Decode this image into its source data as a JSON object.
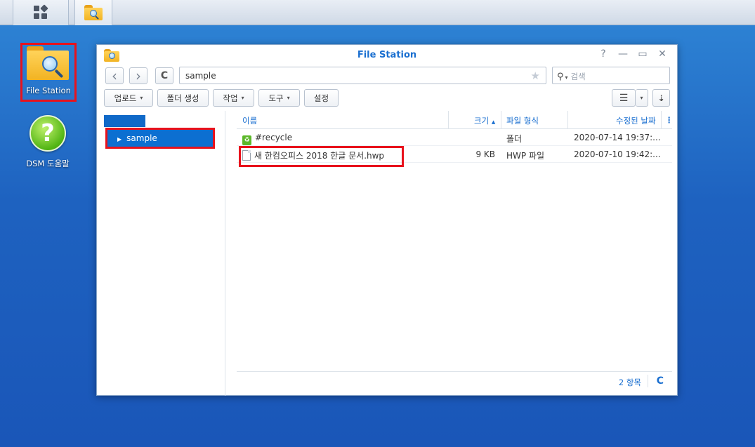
{
  "desktop": {
    "file_station_label": "File Station",
    "help_label": "DSM 도움말",
    "help_glyph": "?"
  },
  "window": {
    "title": "File Station",
    "help_btn": "?",
    "min_btn": "—",
    "max_btn": "▭",
    "close_btn": "✕"
  },
  "nav": {
    "back": "‹",
    "forward": "›",
    "refresh": "C",
    "path": "sample",
    "search_placeholder": "검색"
  },
  "toolbar": {
    "upload": "업로드",
    "new_folder": "폴더 생성",
    "action": "작업",
    "tools": "도구",
    "settings": "설정"
  },
  "tree": {
    "items": [
      {
        "label": "sample"
      }
    ]
  },
  "list": {
    "headers": {
      "name": "이름",
      "size": "크기",
      "type": "파일 형식",
      "modified": "수정된 날짜"
    },
    "rows": [
      {
        "name": "#recycle",
        "size": "",
        "type": "폴더",
        "modified": "2020-07-14 19:37:..."
      },
      {
        "name": "새 한컴오피스 2018 한글 문서.hwp",
        "size": "9 KB",
        "type": "HWP 파일",
        "modified": "2020-07-10 19:42:..."
      }
    ]
  },
  "status": {
    "count": "2 항목"
  },
  "colors": {
    "highlight": "#e8121c",
    "accent": "#1a6fd0",
    "selection": "#0c6fd1"
  }
}
